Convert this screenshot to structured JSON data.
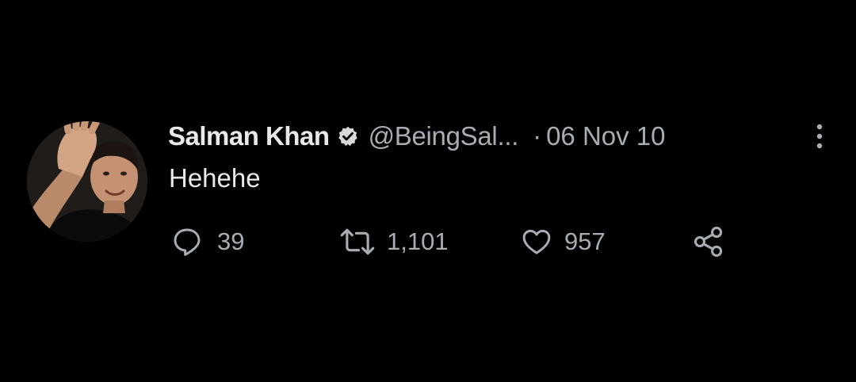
{
  "tweet": {
    "author_name": "Salman Khan",
    "handle": "@BeingSal...",
    "separator": "·",
    "date": "06 Nov 10",
    "text": "Hehehe",
    "verified": true
  },
  "actions": {
    "replies": "39",
    "retweets": "1,101",
    "likes": "957"
  },
  "icons": {
    "verified": "verified-badge-icon",
    "more": "more-options-icon",
    "reply": "reply-icon",
    "retweet": "retweet-icon",
    "like": "heart-icon",
    "share": "share-icon"
  },
  "colors": {
    "background": "#000000",
    "primary_text": "#e7e9ea",
    "secondary_text": "#a8adb3"
  }
}
